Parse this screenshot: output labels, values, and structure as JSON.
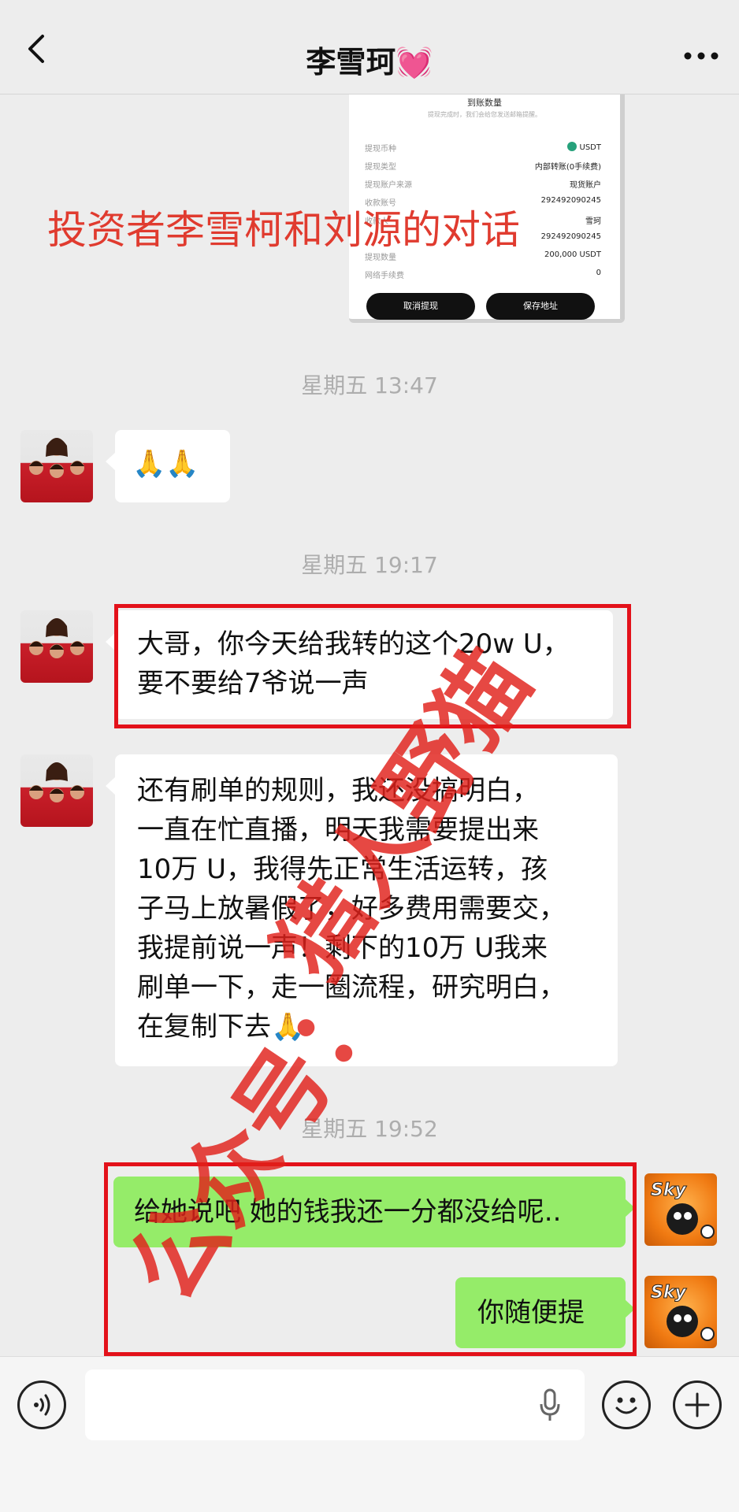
{
  "header": {
    "title": "李雪珂💓"
  },
  "transfer_card": {
    "title": "到账数量",
    "subtitle": "提现完成时，我们会给您发送邮箱提醒。",
    "rows": [
      {
        "label": "提现币种",
        "value": "USDT"
      },
      {
        "label": "提现类型",
        "value": "内部转账(0手续费)"
      },
      {
        "label": "提现账户来源",
        "value": "现货账户"
      },
      {
        "label": "收款账号",
        "value": "292492090245"
      },
      {
        "label": "收款人",
        "value": "雪珂"
      },
      {
        "label": "",
        "value": "292492090245"
      },
      {
        "label": "提现数量",
        "value": "200,000 USDT"
      },
      {
        "label": "网络手续费",
        "value": "0"
      }
    ],
    "cancel_label": "取消提现",
    "save_label": "保存地址"
  },
  "caption": "投资者李雪柯和刘源的对话",
  "messages": {
    "time1": "星期五 13:47",
    "msg1": "🙏🙏",
    "time2": "星期五 19:17",
    "msg2_line1": "大哥，你今天给我转的这个20w U，",
    "msg2_line2": "要不要给7爷说一声",
    "msg3_lines": [
      "还有刷单的规则，我还没搞明白，",
      "一直在忙直播，明天我需要提出来",
      "10万 U，我得先正常生活运转，孩",
      "子马上放暑假了，好多费用需要交，",
      "我提前说一声！剩下的10万 U我来",
      "刷单一下，走一圈流程，研究明白，",
      "在复制下去🙏"
    ],
    "time3": "星期五 19:52",
    "msg4": "给她说吧 她的钱我还一分都没给呢..",
    "msg5": "你随便提"
  },
  "watermark": {
    "line1": "公众号：",
    "line2": "猎人野猫"
  },
  "colors": {
    "chat_background": "#ededed",
    "outgoing_bubble": "#95ec69",
    "incoming_bubble": "#ffffff",
    "highlight_red": "#e3111a",
    "caption_red": "#e03b2f"
  }
}
